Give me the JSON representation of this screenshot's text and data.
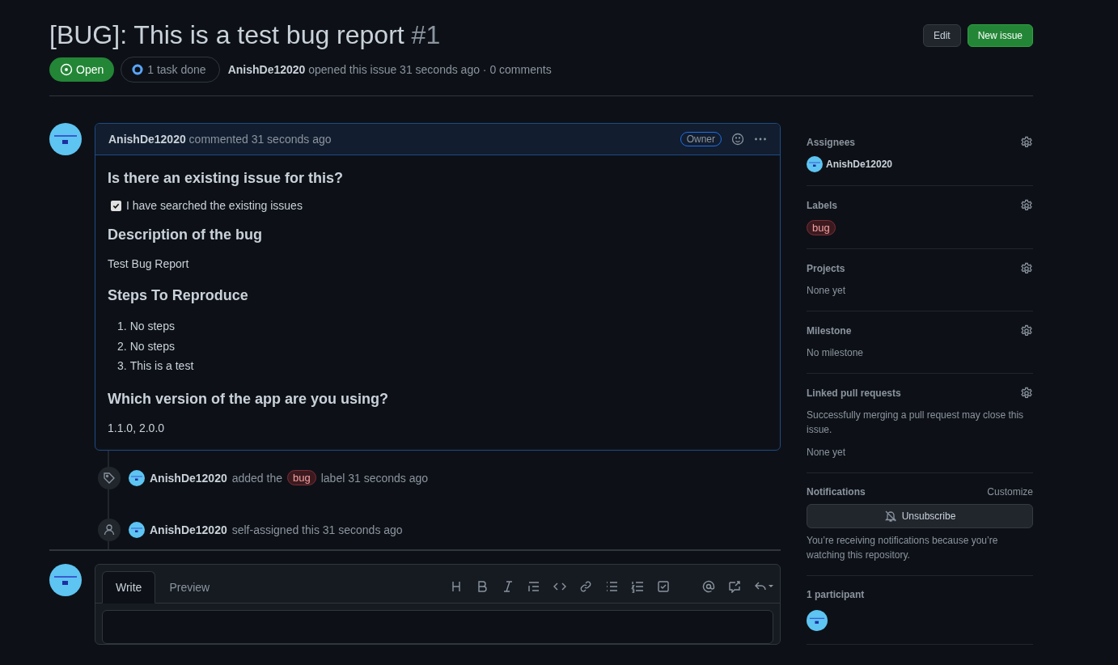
{
  "header": {
    "title": "[BUG]: This is a test bug report",
    "number": "#1",
    "buttons": [
      {
        "label": "Edit",
        "kind": "default"
      },
      {
        "label": "New issue",
        "kind": "primary"
      }
    ],
    "state": {
      "label": "Open"
    },
    "tasks": {
      "label": "1 task done",
      "level": 1
    },
    "author": "AnishDe12020",
    "meta": "opened this issue 31 seconds ago · 0 comments"
  },
  "comment": {
    "author": "AnishDe12020",
    "action": "commented 31 seconds ago",
    "badge": "Owner",
    "body": [
      {
        "kind": "heading",
        "text": "Is there an existing issue for this?"
      },
      {
        "kind": "checkbox",
        "text": "I have searched the existing issues",
        "checked": true
      },
      {
        "kind": "heading",
        "text": "Description of the bug"
      },
      {
        "kind": "paragraph",
        "text": "Test Bug Report"
      },
      {
        "kind": "heading",
        "text": "Steps To Reproduce"
      },
      {
        "kind": "list",
        "items": [
          {
            "marker": "1.",
            "text": "No steps"
          },
          {
            "marker": "2.",
            "text": "No steps"
          },
          {
            "marker": "3.",
            "text": "This is a test"
          }
        ]
      },
      {
        "kind": "heading",
        "text": "Which version of the app are you using?"
      },
      {
        "kind": "paragraph",
        "text": "1.1.0, 2.0.0"
      }
    ]
  },
  "timeline": [
    {
      "kind": "label",
      "author": "AnishDe12020",
      "before": "added the",
      "label": "bug",
      "after": "label 31 seconds ago"
    },
    {
      "kind": "assign",
      "author": "AnishDe12020",
      "text": "self-assigned this 31 seconds ago"
    }
  ],
  "editor": {
    "tabs": [
      {
        "label": "Write",
        "selected": true
      },
      {
        "label": "Preview",
        "selected": false
      }
    ]
  },
  "sidebar": [
    {
      "kind": "users",
      "title": "Assignees",
      "users": [
        "AnishDe12020"
      ]
    },
    {
      "kind": "labels",
      "title": "Labels",
      "labels": [
        "bug"
      ]
    },
    {
      "kind": "text",
      "title": "Projects",
      "lines": [
        "None yet"
      ]
    },
    {
      "kind": "text",
      "title": "Milestone",
      "lines": [
        "No milestone"
      ]
    },
    {
      "kind": "text",
      "title": "Linked pull requests",
      "lines": [
        "Successfully merging a pull request may close this issue.",
        "None yet"
      ]
    },
    {
      "kind": "notifications",
      "title": "Notifications",
      "link": "Customize",
      "button": "Unsubscribe",
      "note": "You’re receiving notifications because you’re watching this repository."
    },
    {
      "kind": "participants",
      "title": "1 participant"
    }
  ]
}
